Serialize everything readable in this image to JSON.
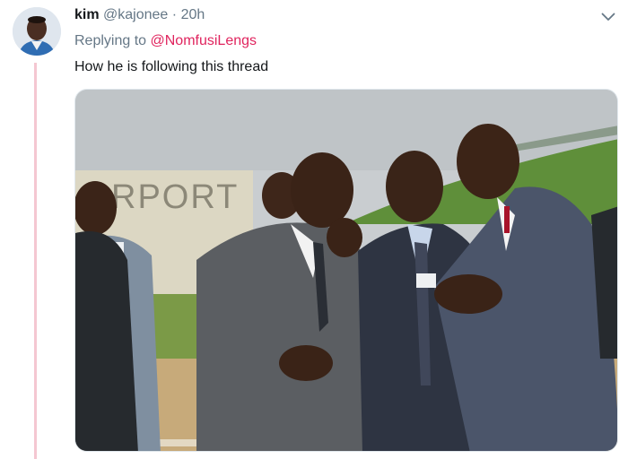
{
  "tweet": {
    "display_name": "kim",
    "handle": "@kajonee",
    "separator": "·",
    "time": "20h",
    "reply_label": "Replying to",
    "reply_to": "@NomfusiLengs",
    "text": "How he is following this thread",
    "menu_icon": "chevron-down-icon"
  },
  "photo": {
    "sign_text": "RPORT"
  },
  "colors": {
    "link": "#e0245e",
    "muted": "#657786",
    "text": "#14171a",
    "thread_line": "#f4c7d1"
  }
}
